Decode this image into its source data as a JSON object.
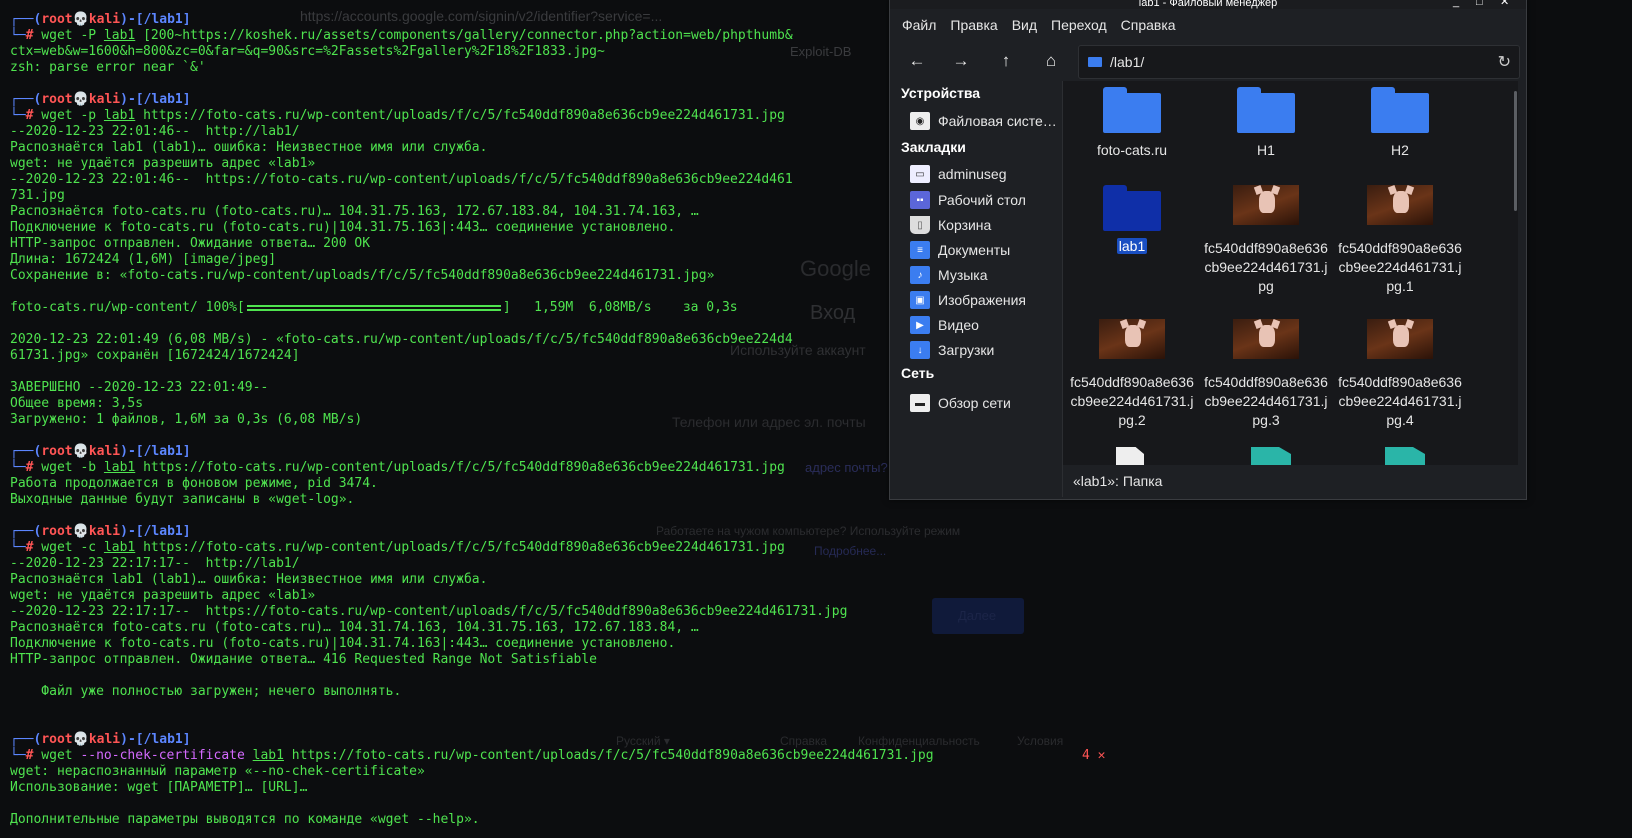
{
  "background_ghost": {
    "url": "https://accounts.google.com/signin/v2/identifier?service=...",
    "google": "Google",
    "login": "Вход",
    "use_account": "Используйте аккаунт",
    "phone_or_email": "Телефон или адрес эл. почты",
    "email_hint": "адрес почты?",
    "not_your_computer": "Работаете на чужом компьютере? Используйте режим",
    "learn_more": "Подробнее...",
    "next": "Далее",
    "lang": "Русский ▾",
    "help": "Справка",
    "privacy": "Конфиденциальность",
    "terms": "Условия",
    "exploit": "Exploit-DB"
  },
  "terminal": {
    "prompt": {
      "open": "┌──(",
      "user": "root",
      "skull": "💀",
      "host": "kali",
      "mid": ")-[",
      "dir": "/lab1",
      "close": "]",
      "arrow": "└─",
      "hash": "#"
    },
    "blocks": [
      {
        "cmd_a": " wget -P ",
        "cmd_dir": "lab1",
        "cmd_rest": " [200~https://koshek.ru/assets/components/gallery/connector.php?action=web/phpthumb&",
        "lines": [
          "ctx=web&w=1600&h=800&zc=0&far=&q=90&src=%2Fassets%2Fgallery%2F18%2F1833.jpg~",
          "zsh: parse error near `&'"
        ]
      },
      {
        "cmd_a": " wget -p ",
        "cmd_dir": "lab1",
        "cmd_rest": " https://foto-cats.ru/wp-content/uploads/f/c/5/fc540ddf890a8e636cb9ee224d461731.jpg",
        "lines": [
          "--2020-12-23 22:01:46--  http://lab1/",
          "Распознаётся lab1 (lab1)… ошибка: Неизвестное имя или служба.",
          "wget: не удаётся разрешить адрес «lab1»",
          "--2020-12-23 22:01:46--  https://foto-cats.ru/wp-content/uploads/f/c/5/fc540ddf890a8e636cb9ee224d461",
          "731.jpg",
          "Распознаётся foto-cats.ru (foto-cats.ru)… 104.31.75.163, 172.67.183.84, 104.31.74.163, …",
          "Подключение к foto-cats.ru (foto-cats.ru)|104.31.75.163|:443… соединение установлено.",
          "HTTP-запрос отправлен. Ожидание ответа… 200 OK",
          "Длина: 1672424 (1,6M) [image/jpeg]",
          "Сохранение в: «foto-cats.ru/wp-content/uploads/f/c/5/fc540ddf890a8e636cb9ee224d461731.jpg»"
        ],
        "progress_left": "foto-cats.ru/wp-content/ 100%[",
        "progress_right": "]   1,59M  6,08MB/s    за 0,3s",
        "lines2": [
          "2020-12-23 22:01:49 (6,08 MB/s) - «foto-cats.ru/wp-content/uploads/f/c/5/fc540ddf890a8e636cb9ee224d4",
          "61731.jpg» сохранён [1672424/1672424]"
        ],
        "lines3": [
          "ЗАВЕРШЕНО --2020-12-23 22:01:49--",
          "Общее время: 3,5s",
          "Загружено: 1 файлов, 1,6M за 0,3s (6,08 MB/s)"
        ]
      },
      {
        "cmd_a": " wget -b ",
        "cmd_dir": "lab1",
        "cmd_rest": " https://foto-cats.ru/wp-content/uploads/f/c/5/fc540ddf890a8e636cb9ee224d461731.jpg",
        "lines": [
          "Работа продолжается в фоновом режиме, pid 3474.",
          "Выходные данные будут записаны в «wget-log»."
        ]
      },
      {
        "cmd_a": " wget -c ",
        "cmd_dir": "lab1",
        "cmd_rest": " https://foto-cats.ru/wp-content/uploads/f/c/5/fc540ddf890a8e636cb9ee224d461731.jpg",
        "lines": [
          "--2020-12-23 22:17:17--  http://lab1/",
          "Распознаётся lab1 (lab1)… ошибка: Неизвестное имя или служба.",
          "wget: не удаётся разрешить адрес «lab1»",
          "--2020-12-23 22:17:17--  https://foto-cats.ru/wp-content/uploads/f/c/5/fc540ddf890a8e636cb9ee224d461731.jpg",
          "Распознаётся foto-cats.ru (foto-cats.ru)… 104.31.74.163, 104.31.75.163, 172.67.183.84, …",
          "Подключение к foto-cats.ru (foto-cats.ru)|104.31.74.163|:443… соединение установлено.",
          "HTTP-запрос отправлен. Ожидание ответа… 416 Requested Range Not Satisfiable",
          "",
          "    Файл уже полностью загружен; нечего выполнять."
        ]
      },
      {
        "cmd_a": " wget ",
        "cmd_flag": "--no-chek-certificate",
        "cmd_dir": "lab1",
        "cmd_rest": " https://foto-cats.ru/wp-content/uploads/f/c/5/fc540ddf890a8e636cb9ee224d461731.jpg",
        "exit_code": "4",
        "exit_mark": "✕",
        "lines": [
          "wget: нераспознанный параметр «--no-chek-certificate»",
          "Использование: wget [ПАРАМЕТР]… [URL]…",
          "",
          "Дополнительные параметры выводятся по команде «wget --help»."
        ]
      }
    ]
  },
  "file_manager": {
    "title": "lab1 - Файловый менеджер",
    "window_buttons": [
      "_",
      "□",
      "✕"
    ],
    "menu": [
      "Файл",
      "Правка",
      "Вид",
      "Переход",
      "Справка"
    ],
    "path": "/lab1/",
    "sidebar": {
      "devices_header": "Устройства",
      "devices": [
        {
          "label": "Файловая систе…",
          "icon": "drive-icon"
        }
      ],
      "bookmarks_header": "Закладки",
      "bookmarks": [
        {
          "label": "adminuseg",
          "icon": "home-folder-icon"
        },
        {
          "label": "Рабочий стол",
          "icon": "desktop-icon"
        },
        {
          "label": "Корзина",
          "icon": "trash-icon"
        },
        {
          "label": "Документы",
          "icon": "documents-icon"
        },
        {
          "label": "Музыка",
          "icon": "music-icon"
        },
        {
          "label": "Изображения",
          "icon": "pictures-icon"
        },
        {
          "label": "Видео",
          "icon": "video-icon"
        },
        {
          "label": "Загрузки",
          "icon": "downloads-icon"
        }
      ],
      "network_header": "Сеть",
      "network": [
        {
          "label": "Обзор сети",
          "icon": "network-icon"
        }
      ]
    },
    "items": [
      {
        "name": "foto-cats.ru",
        "kind": "folder"
      },
      {
        "name": "H1",
        "kind": "folder"
      },
      {
        "name": "H2",
        "kind": "folder"
      },
      {
        "name": "lab1",
        "kind": "folder-selected"
      },
      {
        "name": "fc540ddf890a8e636cb9ee224d461731.jpg",
        "kind": "image"
      },
      {
        "name": "fc540ddf890a8e636cb9ee224d461731.jpg.1",
        "kind": "image"
      },
      {
        "name": "fc540ddf890a8e636cb9ee224d461731.jpg.2",
        "kind": "image"
      },
      {
        "name": "fc540ddf890a8e636cb9ee224d461731.jpg.3",
        "kind": "image"
      },
      {
        "name": "fc540ddf890a8e636cb9ee224d461731.jpg.4",
        "kind": "image"
      }
    ],
    "status": "«lab1»: Папка"
  }
}
